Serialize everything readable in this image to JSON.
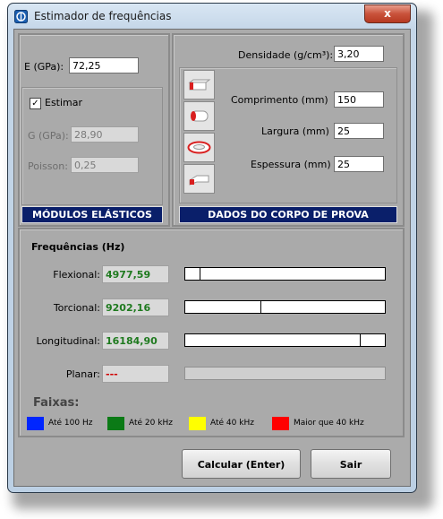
{
  "window": {
    "title": "Estimador de frequências",
    "close_label": "x"
  },
  "elastic": {
    "e_label": "E (GPa):",
    "e_value": "72,25",
    "estimate_label": "Estimar",
    "estimate_checked": true,
    "g_label": "G (GPa):",
    "g_value": "28,90",
    "poisson_label": "Poisson:",
    "poisson_value": "0,25",
    "bar_label": "MÓDULOS ELÁSTICOS"
  },
  "specimen": {
    "density_label": "Densidade (g/cm³):",
    "density_value": "3,20",
    "length_label": "Comprimento (mm)",
    "length_value": "150",
    "width_label": "Largura (mm)",
    "width_value": "25",
    "thickness_label": "Espessura (mm)",
    "thickness_value": "25",
    "shape_icons": [
      "bar-shape-icon",
      "cylinder-shape-icon",
      "disc-shape-icon",
      "other-shape-icon"
    ],
    "bar_label": "DADOS DO CORPO DE PROVA"
  },
  "frequencies": {
    "title": "Frequências (Hz)",
    "rows": [
      {
        "label": "Flexional:",
        "value": "4977,59",
        "level": 0.07
      },
      {
        "label": "Torcional:",
        "value": "9202,16",
        "level": 0.38
      },
      {
        "label": "Longitudinal:",
        "value": "16184,90",
        "level": 0.88
      },
      {
        "label": "Planar:",
        "value": "---",
        "level": null
      }
    ]
  },
  "bands": {
    "title": "Faixas:",
    "items": [
      {
        "label": "Até 100 Hz",
        "color": "#0026ff"
      },
      {
        "label": "Até 20 kHz",
        "color": "#0b7a16"
      },
      {
        "label": "Até 40 kHz",
        "color": "#ffff00"
      },
      {
        "label": "Maior que 40 kHz",
        "color": "#ff0000"
      }
    ]
  },
  "actions": {
    "calculate_label": "Calcular (Enter)",
    "exit_label": "Sair"
  }
}
